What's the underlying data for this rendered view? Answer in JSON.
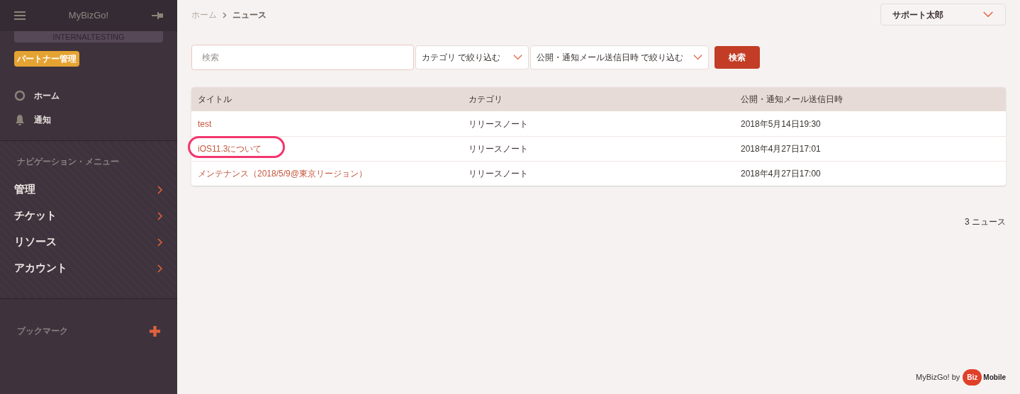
{
  "sidebar": {
    "app_title": "MyBizGo!",
    "environment": "INTERNALTESTING",
    "role_badge": "パートナー管理",
    "quick_links": [
      {
        "kind": "home",
        "label": "ホーム"
      },
      {
        "kind": "bell",
        "label": "通知"
      }
    ],
    "nav_heading": "ナビゲーション・メニュー",
    "nav_items": [
      {
        "label": "管理"
      },
      {
        "label": "チケット"
      },
      {
        "label": "リソース"
      },
      {
        "label": "アカウント"
      }
    ],
    "bookmarks_heading": "ブックマーク"
  },
  "breadcrumb": [
    {
      "label": "ホーム",
      "current": false
    },
    {
      "label": "ニュース",
      "current": true
    }
  ],
  "user_menu": {
    "label": "サポート太郎"
  },
  "filters": {
    "search": {
      "placeholder": "検索"
    },
    "category": "カテゴリ で絞り込む",
    "date": "公開・通知メール送信日時 で絞り込む",
    "search_button": "検索"
  },
  "table": {
    "columns": [
      "タイトル",
      "カテゴリ",
      "公開・通知メール送信日時"
    ],
    "rows": [
      {
        "title": "test",
        "category": "リリースノート",
        "date": "2018年5月14日19:30",
        "circled": false
      },
      {
        "title": "iOS11.3について",
        "category": "リリースノート",
        "date": "2018年4月27日17:01",
        "circled": true
      },
      {
        "title": "メンテナンス（2018/5/9@東京リージョン）",
        "category": "リリースノート",
        "date": "2018年4月27日17:00",
        "circled": false
      }
    ]
  },
  "count": "3 ニュース",
  "footer": {
    "text": "MyBizGo! by",
    "logo_part_1": "Biz",
    "logo_part_2": "Mobile"
  }
}
